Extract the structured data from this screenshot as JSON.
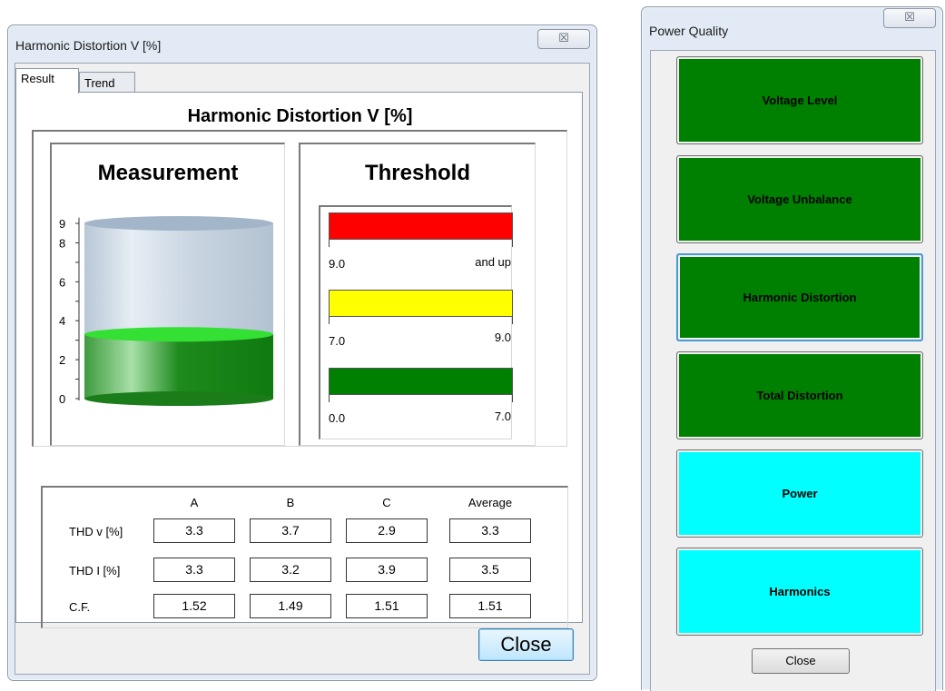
{
  "hd_window": {
    "title": "Harmonic Distortion V [%]",
    "close_glyph": "☒",
    "tabs": [
      {
        "label": "Result",
        "active": true
      },
      {
        "label": "Trend",
        "active": false
      }
    ],
    "panel_title": "Harmonic Distortion V [%]",
    "measurement": {
      "title": "Measurement",
      "axis_ticks": [
        "9",
        "8",
        "6",
        "4",
        "2",
        "0"
      ],
      "axis_max": 9,
      "level": 3.3,
      "fill_color": "#0a8a0a",
      "fill_top_color": "#33e033"
    },
    "threshold": {
      "title": "Threshold",
      "bands": [
        {
          "color": "#ff0000",
          "low": "9.0",
          "high": "and up"
        },
        {
          "color": "#ffff00",
          "low": "7.0",
          "high": "9.0"
        },
        {
          "color": "#008000",
          "low": "0.0",
          "high": "7.0"
        }
      ]
    },
    "table": {
      "columns": [
        "A",
        "B",
        "C",
        "Average"
      ],
      "rows": [
        {
          "label": "THD v [%]",
          "values": [
            "3.3",
            "3.7",
            "2.9",
            "3.3"
          ]
        },
        {
          "label": "THD I [%]",
          "values": [
            "3.3",
            "3.2",
            "3.9",
            "3.5"
          ]
        },
        {
          "label": "C.F.",
          "values": [
            "1.52",
            "1.49",
            "1.51",
            "1.51"
          ]
        }
      ]
    },
    "close_button": "Close"
  },
  "pq_window": {
    "title": "Power Quality",
    "close_glyph": "☒",
    "buttons": [
      {
        "label": "Voltage Level",
        "color": "#008000"
      },
      {
        "label": "Voltage Unbalance",
        "color": "#008000"
      },
      {
        "label": "Harmonic Distortion",
        "color": "#008000",
        "focused": true
      },
      {
        "label": "Total Distortion",
        "color": "#008000"
      },
      {
        "label": "Power",
        "color": "#00ffff"
      },
      {
        "label": "Harmonics",
        "color": "#00ffff"
      }
    ],
    "close_button": "Close"
  }
}
